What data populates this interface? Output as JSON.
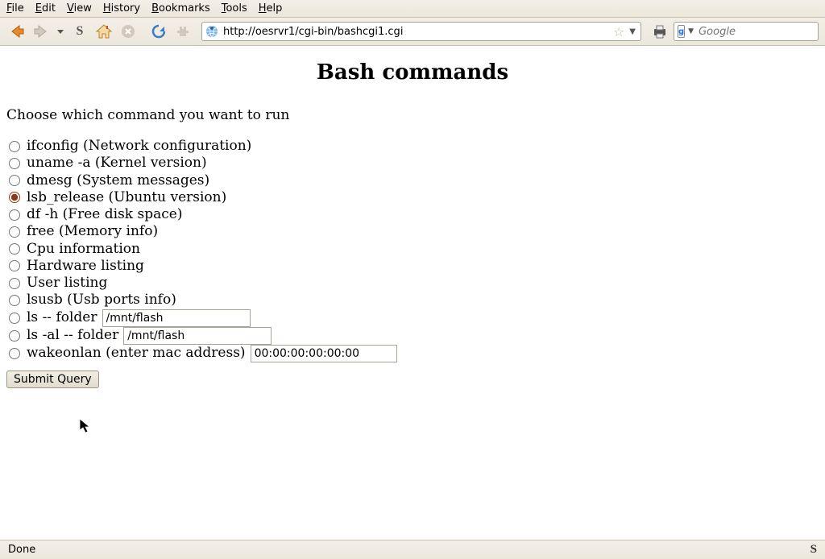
{
  "menubar": {
    "file": "File",
    "edit": "Edit",
    "view": "View",
    "history": "History",
    "bookmarks": "Bookmarks",
    "tools": "Tools",
    "help": "Help"
  },
  "toolbar": {
    "url": "http://oesrvr1/cgi-bin/bashcgi1.cgi",
    "search_placeholder": "Google"
  },
  "page": {
    "title": "Bash commands",
    "prompt": "Choose which command you want to run",
    "options": [
      {
        "id": "ifconfig",
        "label": "ifconfig (Network configuration)",
        "checked": false
      },
      {
        "id": "uname",
        "label": "uname -a (Kernel version)",
        "checked": false
      },
      {
        "id": "dmesg",
        "label": "dmesg (System messages)",
        "checked": false
      },
      {
        "id": "lsb",
        "label": "lsb_release (Ubuntu version)",
        "checked": true
      },
      {
        "id": "df",
        "label": "df -h (Free disk space)",
        "checked": false
      },
      {
        "id": "free",
        "label": "free (Memory info)",
        "checked": false
      },
      {
        "id": "cpu",
        "label": "Cpu information",
        "checked": false
      },
      {
        "id": "hw",
        "label": "Hardware listing",
        "checked": false
      },
      {
        "id": "users",
        "label": "User listing",
        "checked": false
      },
      {
        "id": "lsusb",
        "label": "lsusb (Usb ports info)",
        "checked": false
      },
      {
        "id": "ls",
        "label": "ls -- folder",
        "checked": false,
        "input_value": "/mnt/flash",
        "input_width": 184
      },
      {
        "id": "lsal",
        "label": "ls -al -- folder",
        "checked": false,
        "input_value": "/mnt/flash",
        "input_width": 184
      },
      {
        "id": "wol",
        "label": "wakeonlan (enter mac address)",
        "checked": false,
        "input_value": "00:00:00:00:00:00",
        "input_width": 182
      }
    ],
    "submit_label": "Submit Query"
  },
  "statusbar": {
    "left": "Done",
    "right": "S"
  }
}
